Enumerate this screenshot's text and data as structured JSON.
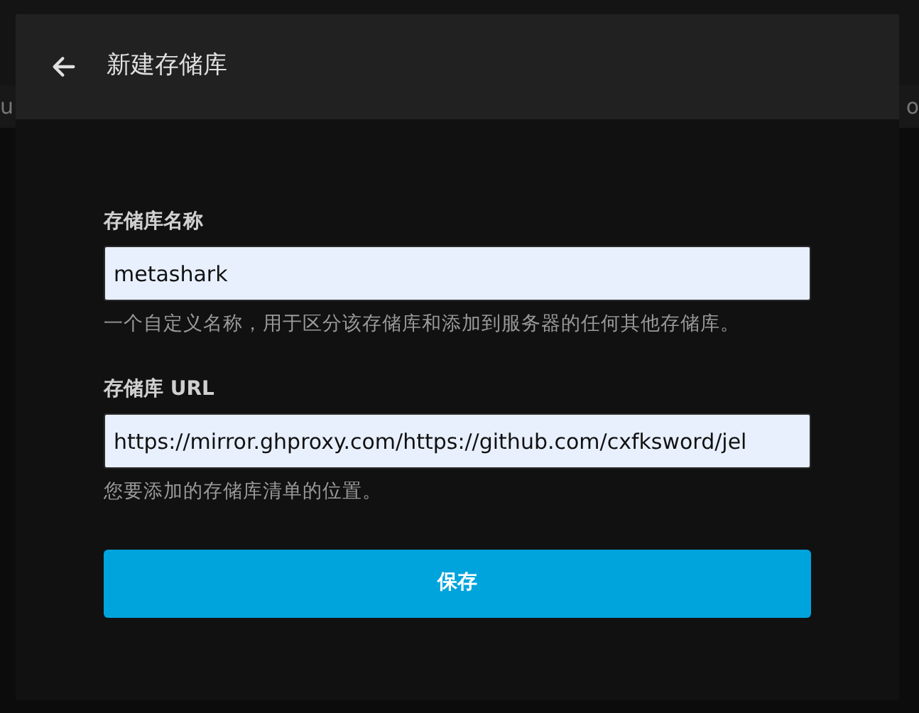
{
  "background": {
    "left_fragment": "u",
    "right_fragment": "o"
  },
  "dialog": {
    "title": "新建存储库",
    "fields": [
      {
        "label": "存储库名称",
        "value": "metashark",
        "help": "一个自定义名称，用于区分该存储库和添加到服务器的任何其他存储库。"
      },
      {
        "label": "存储库 URL",
        "value": "https://mirror.ghproxy.com/https://github.com/cxfksword/jel",
        "help": "您要添加的存储库清单的位置。"
      }
    ],
    "save_button": "保存"
  }
}
